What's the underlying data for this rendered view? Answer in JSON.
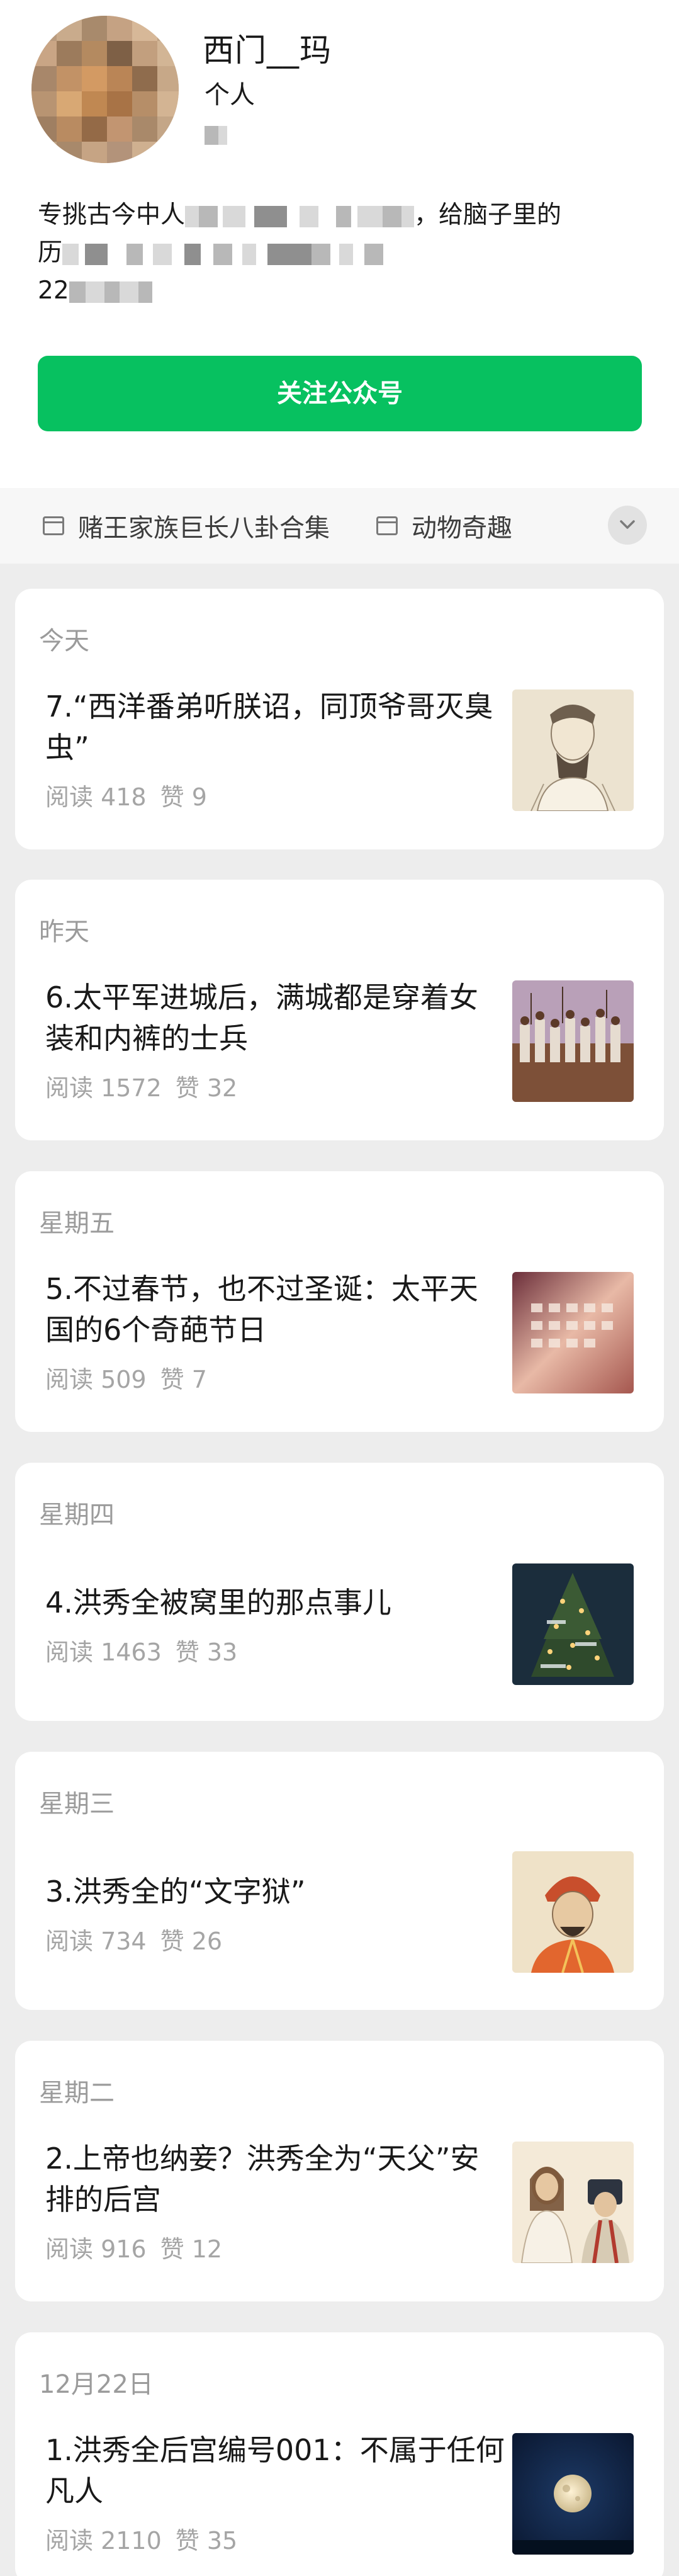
{
  "profile": {
    "name": "西门__玛",
    "type": "个人",
    "description_line1": "专挑古今中人",
    "description_line1_end": "，给脑子里的",
    "description_line2": "历",
    "count_prefix": "22",
    "follow_label": "关注公众号"
  },
  "tags": [
    {
      "label": "赌王家族巨长八卦合集",
      "icon": "folder-icon"
    },
    {
      "label": "动物奇趣",
      "icon": "folder-icon"
    }
  ],
  "articles": [
    {
      "date": "今天",
      "title": "7.“西洋番弟听朕诏，同顶爷哥灭臭虫”",
      "reads": "阅读 418",
      "likes": "赞 9",
      "thumb": "ancient-portrait"
    },
    {
      "date": "昨天",
      "title": "6.太平军进城后，满城都是穿着女装和内裤的士兵",
      "reads": "阅读 1572",
      "likes": "赞 32",
      "thumb": "soldiers-painting"
    },
    {
      "date": "星期五",
      "title": "5.不过春节，也不过圣诞：太平天国的6个奇葩节日",
      "reads": "阅读 509",
      "likes": "赞 7",
      "thumb": "calendar-photo"
    },
    {
      "date": "星期四",
      "title": "4.洪秀全被窝里的那点事儿",
      "reads": "阅读 1463",
      "likes": "赞 33",
      "thumb": "christmas-tree"
    },
    {
      "date": "星期三",
      "title": "3.洪秀全的“文字狱”",
      "reads": "阅读 734",
      "likes": "赞 26",
      "thumb": "emperor-portrait"
    },
    {
      "date": "星期二",
      "title": "2.上帝也纳妾？洪秀全为“天父”安排的后宫",
      "reads": "阅读 916",
      "likes": "赞 12",
      "thumb": "jesus-painting"
    },
    {
      "date": "12月22日",
      "title": "1.洪秀全后宫编号001：不属于任何凡人",
      "reads": "阅读 2110",
      "likes": "赞 35",
      "thumb": "moon-photo"
    }
  ],
  "colors": {
    "accent": "#07c160",
    "background": "#ededed",
    "muted": "#a5a5a5"
  }
}
